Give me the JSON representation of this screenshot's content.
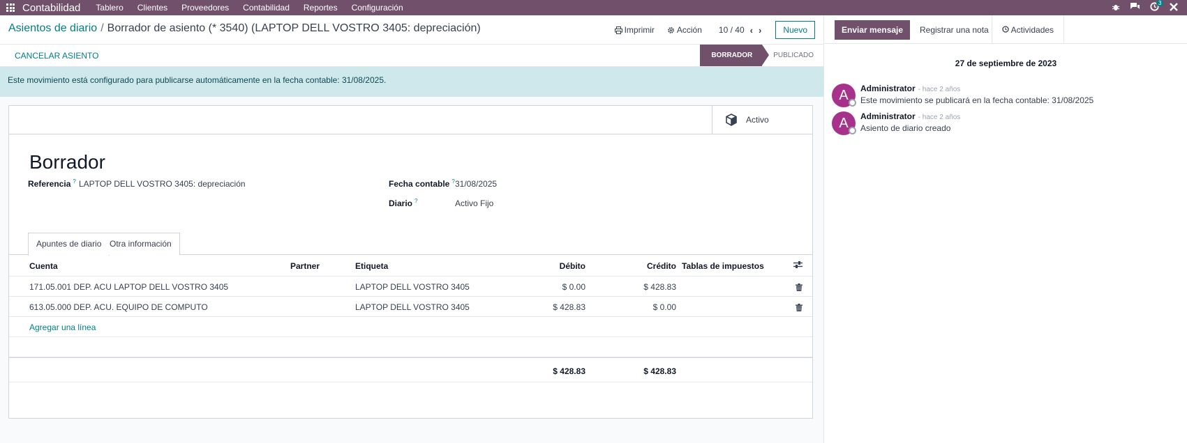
{
  "nav": {
    "brand": "Contabilidad",
    "menu": [
      "Tablero",
      "Clientes",
      "Proveedores",
      "Contabilidad",
      "Reportes",
      "Configuración"
    ],
    "activity_count": "3"
  },
  "breadcrumb": {
    "parent": "Asientos de diario",
    "current": "Borrador de asiento (* 3540) (LAPTOP DELL VOSTRO 3405: depreciación)"
  },
  "actions": {
    "print": "Imprimir",
    "action": "Acción",
    "pager": "10 / 40",
    "new": "Nuevo"
  },
  "status": {
    "cancel": "CANCELAR ASIENTO",
    "states": [
      "BORRADOR",
      "PUBLICADO"
    ]
  },
  "alert": "Este movimiento está configurado para publicarse automáticamente en la fecha contable: 31/08/2025.",
  "smart_button": "Activo",
  "form": {
    "title": "Borrador",
    "referencia_label": "Referencia",
    "referencia_value": "LAPTOP DELL VOSTRO 3405: depreciación",
    "fecha_label": "Fecha contable",
    "fecha_value": "31/08/2025",
    "diario_label": "Diario",
    "diario_value": "Activo Fijo",
    "help": "?"
  },
  "tabs": [
    "Apuntes de diario",
    "Otra información"
  ],
  "lines": {
    "headers": {
      "cuenta": "Cuenta",
      "partner": "Partner",
      "etiqueta": "Etiqueta",
      "debito": "Débito",
      "credito": "Crédito",
      "tablas": "Tablas de impuestos"
    },
    "rows": [
      {
        "cuenta": "171.05.001 DEP. ACU LAPTOP DELL VOSTRO 3405",
        "partner": "",
        "etiqueta": "LAPTOP DELL VOSTRO 3405",
        "debito": "$ 0.00",
        "credito": "$ 428.83"
      },
      {
        "cuenta": "613.05.000 DEP. ACU. EQUIPO DE COMPUTO",
        "partner": "",
        "etiqueta": "LAPTOP DELL VOSTRO 3405",
        "debito": "$ 428.83",
        "credito": "$ 0.00"
      }
    ],
    "add_line": "Agregar una línea",
    "total_debito": "$ 428.83",
    "total_credito": "$ 428.83"
  },
  "chatter": {
    "send": "Enviar mensaje",
    "note": "Registrar una nota",
    "activities": "Actividades",
    "date": "27 de septiembre de 2023",
    "messages": [
      {
        "initial": "A",
        "author": "Administrator",
        "time": "- hace 2 años",
        "body": "Este movimiento se publicará en la fecha contable: 31/08/2025"
      },
      {
        "initial": "A",
        "author": "Administrator",
        "time": "- hace 2 años",
        "body": "Asiento de diario creado"
      }
    ]
  },
  "colors": {
    "brand": "#71506b",
    "accent": "#017e84",
    "alert_bg": "#cfe8ec",
    "avatar": "#a7328c"
  }
}
